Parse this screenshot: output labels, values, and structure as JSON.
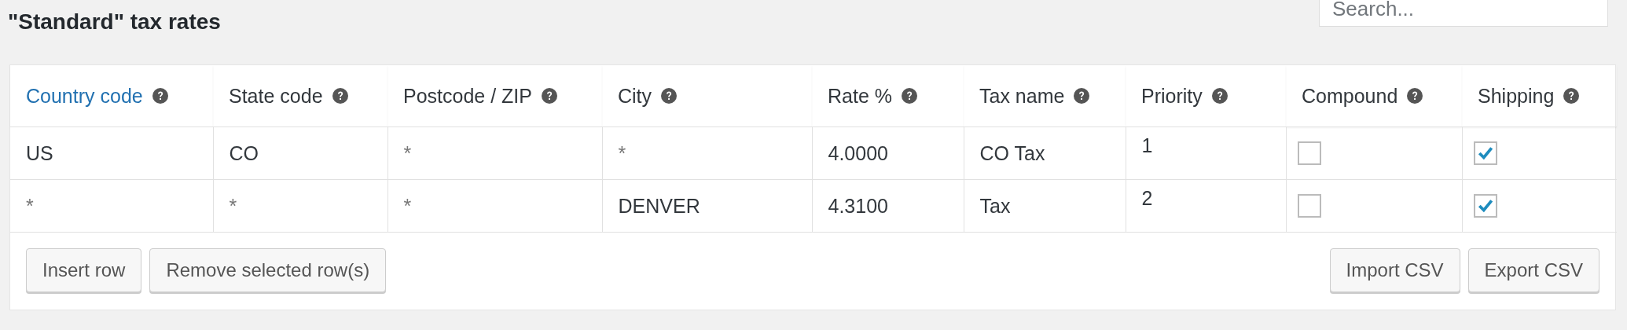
{
  "title": "\"Standard\" tax rates",
  "search": {
    "placeholder": "Search..."
  },
  "table": {
    "columns": [
      {
        "label": "Country code",
        "kind": "text",
        "link": true
      },
      {
        "label": "State code",
        "kind": "text",
        "link": false
      },
      {
        "label": "Postcode / ZIP",
        "kind": "text",
        "link": false
      },
      {
        "label": "City",
        "kind": "text",
        "link": false
      },
      {
        "label": "Rate %",
        "kind": "text",
        "link": false
      },
      {
        "label": "Tax name",
        "kind": "text",
        "link": false
      },
      {
        "label": "Priority",
        "kind": "text",
        "link": false
      },
      {
        "label": "Compound",
        "kind": "checkbox",
        "link": false
      },
      {
        "label": "Shipping",
        "kind": "checkbox",
        "link": false
      }
    ],
    "rows": [
      {
        "cells": [
          {
            "value": "US"
          },
          {
            "value": "CO"
          },
          {
            "placeholder": "*"
          },
          {
            "placeholder": "*"
          },
          {
            "value": "4.0000"
          },
          {
            "value": "CO Tax"
          },
          {
            "value": "1"
          },
          {
            "checked": false
          },
          {
            "checked": true
          }
        ]
      },
      {
        "cells": [
          {
            "placeholder": "*"
          },
          {
            "placeholder": "*"
          },
          {
            "placeholder": "*"
          },
          {
            "value": "DENVER"
          },
          {
            "value": "4.3100"
          },
          {
            "value": "Tax"
          },
          {
            "value": "2"
          },
          {
            "checked": false
          },
          {
            "checked": true
          }
        ]
      }
    ]
  },
  "left_buttons": [
    "Insert row",
    "Remove selected row(s)"
  ],
  "right_buttons": [
    "Import CSV",
    "Export CSV"
  ]
}
